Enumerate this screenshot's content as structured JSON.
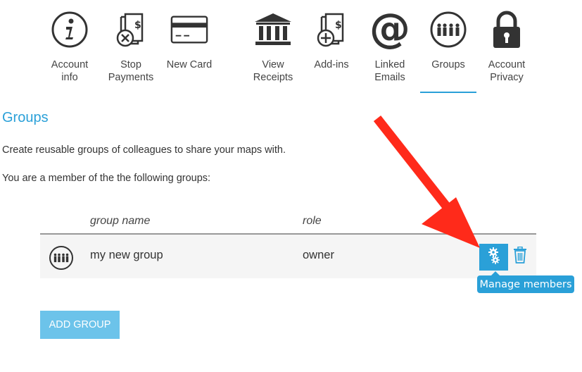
{
  "nav": {
    "items": [
      {
        "label": "Account\ninfo",
        "icon": "info-icon"
      },
      {
        "label": "Stop\nPayments",
        "icon": "stop-payment-icon"
      },
      {
        "label": "New Card",
        "icon": "credit-card-icon"
      },
      {
        "label": "View\nReceipts",
        "icon": "bank-icon"
      },
      {
        "label": "Add-ins",
        "icon": "add-document-icon"
      },
      {
        "label": "Linked\nEmails",
        "icon": "at-sign-icon"
      },
      {
        "label": "Groups",
        "icon": "group-icon"
      },
      {
        "label": "Account\nPrivacy",
        "icon": "lock-icon"
      }
    ],
    "active": "Groups"
  },
  "page": {
    "title": "Groups",
    "description": "Create reusable groups of colleagues to share your maps with.",
    "member_text": "You are a member of the the following groups:"
  },
  "table": {
    "headers": {
      "name": "group name",
      "role": "role"
    },
    "rows": [
      {
        "name": "my new group",
        "role": "owner"
      }
    ]
  },
  "actions": {
    "tooltip": "Manage members",
    "add_group": "ADD GROUP"
  },
  "colors": {
    "accent": "#2aa0d8",
    "button_light": "#6cc3ea",
    "arrow": "#ff2a1a"
  }
}
